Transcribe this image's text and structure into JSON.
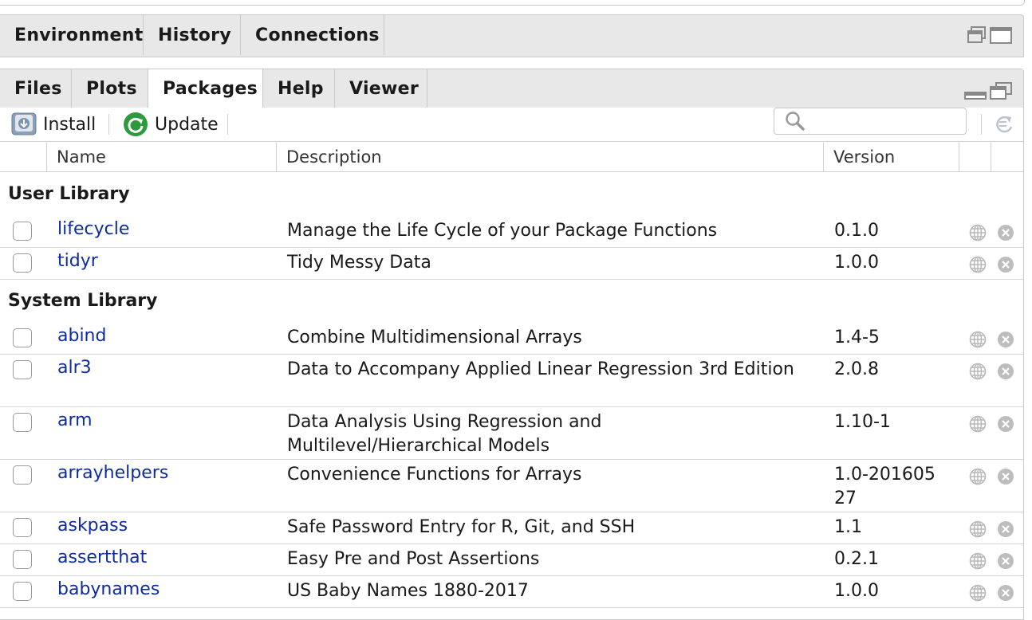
{
  "top_pane": {
    "tabs": [
      "Environment",
      "History",
      "Connections"
    ]
  },
  "bottom_pane": {
    "tabs": [
      "Files",
      "Plots",
      "Packages",
      "Help",
      "Viewer"
    ],
    "active_tab": "Packages"
  },
  "toolbar": {
    "install_label": "Install",
    "update_label": "Update",
    "search_placeholder": ""
  },
  "table": {
    "columns": [
      "Name",
      "Description",
      "Version"
    ]
  },
  "user_library": {
    "title": "User Library",
    "packages": [
      {
        "name": "lifecycle",
        "description": "Manage the Life Cycle of your Package Functions",
        "version": "0.1.0"
      },
      {
        "name": "tidyr",
        "description": "Tidy Messy Data",
        "version": "1.0.0"
      }
    ]
  },
  "system_library": {
    "title": "System Library",
    "packages": [
      {
        "name": "abind",
        "description": "Combine Multidimensional Arrays",
        "version": "1.4-5"
      },
      {
        "name": "alr3",
        "description": "Data to Accompany Applied Linear Regression 3rd Edition",
        "version": "2.0.8"
      },
      {
        "name": "arm",
        "description": "Data Analysis Using Regression and Multilevel/Hierarchical Models",
        "version": "1.10-1"
      },
      {
        "name": "arrayhelpers",
        "description": "Convenience Functions for Arrays",
        "version": "1.0-20160527"
      },
      {
        "name": "askpass",
        "description": "Safe Password Entry for R, Git, and SSH",
        "version": "1.1"
      },
      {
        "name": "assertthat",
        "description": "Easy Pre and Post Assertions",
        "version": "0.2.1"
      },
      {
        "name": "babynames",
        "description": "US Baby Names 1880-2017",
        "version": "1.0.0"
      }
    ]
  },
  "colors": {
    "link": "#0f2c9e",
    "pane_bg": "#e8e8e8",
    "update_icon": "#2e9a3e"
  }
}
